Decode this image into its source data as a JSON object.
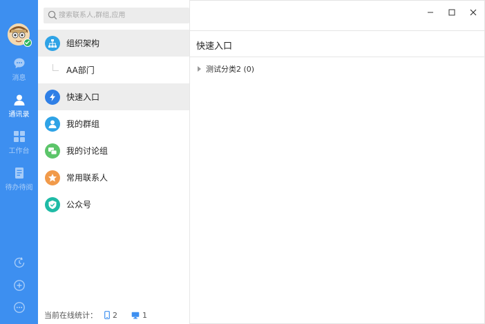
{
  "colors": {
    "rail": "#3d8ff0",
    "accent_blue": "#2f7fe6",
    "teal": "#1fbba6",
    "green": "#5cc56a",
    "orange": "#f19a4a",
    "cyan": "#2fa3e6"
  },
  "rail": {
    "items": [
      {
        "label": "消息",
        "icon": "chat-bubble-icon"
      },
      {
        "label": "通讯录",
        "icon": "contacts-person-icon"
      },
      {
        "label": "工作台",
        "icon": "grid-apps-icon"
      },
      {
        "label": "待办待阅",
        "icon": "todo-doc-icon"
      }
    ],
    "bottom": [
      {
        "icon": "history-clock-icon"
      },
      {
        "icon": "add-circle-icon"
      },
      {
        "icon": "more-circle-icon"
      }
    ]
  },
  "search": {
    "placeholder": "搜索联系人,群组,应用"
  },
  "tree": {
    "items": [
      {
        "label": "组织架构",
        "icon": "org-structure-icon"
      },
      {
        "label": "AA部门"
      },
      {
        "label": "快速入口",
        "icon": "lightning-icon"
      },
      {
        "label": "我的群组",
        "icon": "group-person-icon"
      },
      {
        "label": "我的讨论组",
        "icon": "discussion-icon"
      },
      {
        "label": "常用联系人",
        "icon": "star-icon"
      },
      {
        "label": "公众号",
        "icon": "verified-badge-icon"
      }
    ]
  },
  "footer": {
    "label": "当前在线统计：",
    "mobile_count": "2",
    "desktop_count": "1"
  },
  "content": {
    "title": "快速入口",
    "category": "测试分类2 (0)"
  }
}
